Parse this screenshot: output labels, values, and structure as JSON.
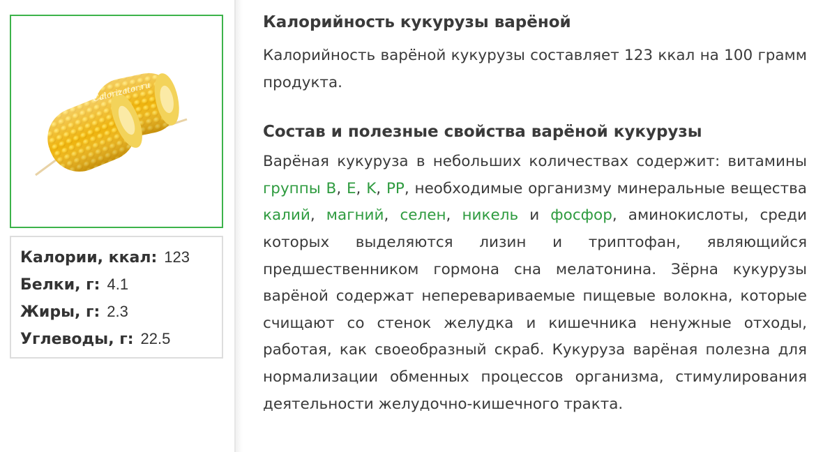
{
  "product": {
    "image_alt": "варёная кукуруза",
    "watermark": "Calorizator.ru",
    "image_icon": "corn-cob-icon"
  },
  "nutrition": {
    "rows": [
      {
        "label": "Калории, ккал:",
        "value": "123"
      },
      {
        "label": "Белки, г:",
        "value": "4.1"
      },
      {
        "label": "Жиры, г:",
        "value": "2.3"
      },
      {
        "label": "Углеводы, г:",
        "value": "22.5"
      }
    ]
  },
  "article": {
    "heading1": "Калорийность кукурузы варёной",
    "para1": "Калорийность варёной кукурузы составляет 123 ккал на 100 грамм продукта.",
    "heading2": "Состав и полезные свойства варёной кукурузы",
    "para2": {
      "t0": "Варёная кукуруза в небольших количествах содержит: витамины ",
      "l_groupB": "группы B",
      "s1": ", ",
      "l_E": "E",
      "s2": ", ",
      "l_K": "K",
      "s3": ", ",
      "l_PP": "PP",
      "t1": ", необходимые организму минеральные вещества ",
      "l_kaliy": "калий",
      "s4": ", ",
      "l_magniy": "магний",
      "s5": ", ",
      "l_selen": "селен",
      "s6": ", ",
      "l_nikel": "никель",
      "t2": " и ",
      "l_fosfor": "фосфор",
      "t3": ", аминокислоты, среди которых выделяются лизин и триптофан, являющийся предшественником гормона сна мелатонина. Зёрна кукурузы варёной содержат неперевариваемые пищевые волокна, которые счищают со стенок желудка и кишечника ненужные отходы, работая, как своеобразный скраб. Кукуруза варёная полезна для нормализации обменных процессов организма, стимулирования деятельности желудочно-кишечного тракта."
    }
  },
  "colors": {
    "link": "#2e9b3f",
    "image_border": "#3cb34a",
    "text": "#3a3a3a"
  }
}
